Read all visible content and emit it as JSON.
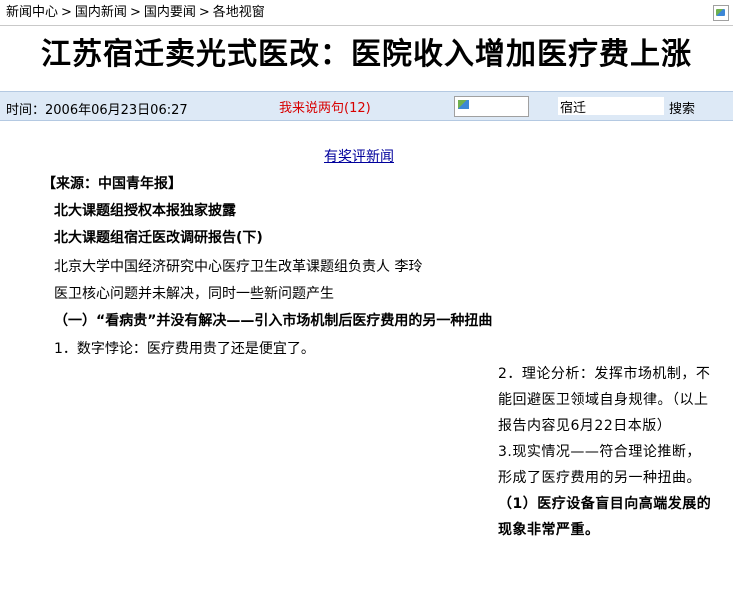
{
  "breadcrumb": [
    "新闻中心",
    "国内新闻",
    "国内要闻",
    "各地视窗"
  ],
  "breadcrumb_sep": ">",
  "article": {
    "title": "江苏宿迁卖光式医改：医院收入增加医疗费上涨",
    "time": "时间：2006年06月23日06:27",
    "comment_link": "我来说两句(12)"
  },
  "search": {
    "value": "宿迁",
    "button": "搜索"
  },
  "reward_link": "有奖评新闻",
  "body": {
    "source": "【来源：中国青年报】",
    "line1": "北大课题组授权本报独家披露",
    "line2": "北大课题组宿迁医改调研报告(下)",
    "line3": "北京大学中国经济研究中心医疗卫生改革课题组负责人 李玲",
    "line4": "医卫核心问题并未解决，同时一些新问题产生",
    "line5": "（一）“看病贵”并没有解决——引入市场机制后医疗费用的另一种扭曲",
    "line6": "1．数字悖论：医疗费用贵了还是便宜了。",
    "col_p1": "2．理论分析：发挥市场机制，不能回避医卫领域自身规律。（以上报告内容见6月22日本版）",
    "col_p2": "3.现实情况——符合理论推断，形成了医疗费用的另一种扭曲。",
    "col_p3": "（1）医疗设备盲目向高端发展的现象非常严重。"
  }
}
